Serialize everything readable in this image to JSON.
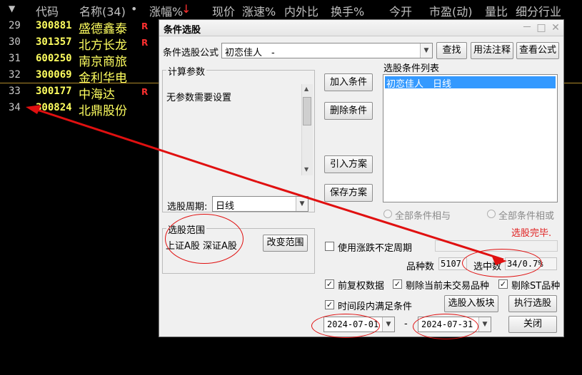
{
  "header": {
    "arrow": "▼",
    "code": "代码",
    "name": "名称(34)",
    "dot": "•",
    "change": "涨幅%",
    "sort_icon": "↓",
    "price": "现价",
    "speed": "涨速%",
    "in_out": "内外比",
    "turnover": "换手%",
    "open": "今开",
    "pe": "市盈(动)",
    "vol_ratio": "量比",
    "industry": "细分行业"
  },
  "rows": [
    {
      "idx": "29",
      "code": "300881",
      "name": "盛德鑫泰",
      "flag": "R"
    },
    {
      "idx": "30",
      "code": "301357",
      "name": "北方长龙",
      "flag": "R"
    },
    {
      "idx": "31",
      "code": "600250",
      "name": "南京商旅",
      "flag": ""
    },
    {
      "idx": "32",
      "code": "300069",
      "name": "金利华电",
      "flag": ""
    },
    {
      "idx": "33",
      "code": "300177",
      "name": "中海达",
      "flag": "R"
    },
    {
      "idx": "34",
      "code": "300824",
      "name": "北鼎股份",
      "flag": ""
    }
  ],
  "dialog": {
    "title": "条件选股",
    "formula_label": "条件选股公式",
    "formula_value": "初恋佳人　-",
    "find_button": "查找",
    "usage_button": "用法注释",
    "view_formula_button": "查看公式",
    "params_group": "计算参数",
    "params_text": "无参数需要设置",
    "add_condition": "加入条件",
    "delete_condition": "删除条件",
    "import_plan": "引入方案",
    "save_plan": "保存方案",
    "cond_list_label": "选股条件列表",
    "cond_list_items": [
      "初恋佳人　日线"
    ],
    "period_label": "选股周期:",
    "period_value": "日线",
    "all_and": "全部条件相与",
    "all_or": "全部条件相或",
    "status": "选股完毕.",
    "range_group": "选股范围",
    "range_text": "上证A股 深证A股",
    "change_range": "改变范围",
    "use_period_label": "使用涨跌不定周期",
    "count_label": "品种数",
    "count_value": "5107",
    "selected_label": "选中数",
    "selected_value": "34/0.7%",
    "pre_adjust": "前复权数据",
    "exclude_untraded": "剔除当前未交易品种",
    "exclude_st": "剔除ST品种",
    "time_period": "时间段内满足条件",
    "to_block_button": "选股入板块",
    "execute_button": "执行选股",
    "start_date": "2024-07-01",
    "date_sep": "-",
    "end_date": "2024-07-31",
    "close_button": "关闭",
    "minimize": "－",
    "restore": "□",
    "close_x": "✕"
  },
  "colors": {
    "background": "#000000",
    "stock_text": "#ffff60",
    "flag": "#ff3030",
    "selection": "#3399ff",
    "annotation": "#e01010",
    "status": "#e02020"
  },
  "icons": {
    "dropdown": "▼",
    "scroll_up": "▲",
    "scroll_down": "▼",
    "check": "✓"
  }
}
